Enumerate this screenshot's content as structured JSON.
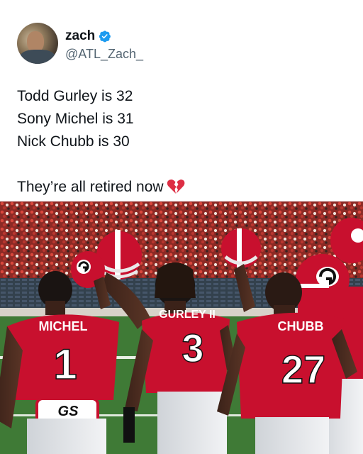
{
  "author": {
    "display_name": "zach",
    "handle": "@ATL_Zach_",
    "verified": true,
    "verified_color": "#1d9bf0"
  },
  "tweet": {
    "lines": [
      "Todd Gurley is 32",
      "Sony Michel is 31",
      "Nick Chubb is 30",
      "",
      "They’re all retired now"
    ],
    "emoji": "broken-heart"
  },
  "photo": {
    "jersey_color": "#c8102e",
    "players": [
      {
        "name": "MICHEL",
        "number": "1"
      },
      {
        "name": "GURLEY II",
        "number": "3"
      },
      {
        "name": "CHUBB",
        "number": "27"
      }
    ],
    "belt_logo": "GS"
  }
}
